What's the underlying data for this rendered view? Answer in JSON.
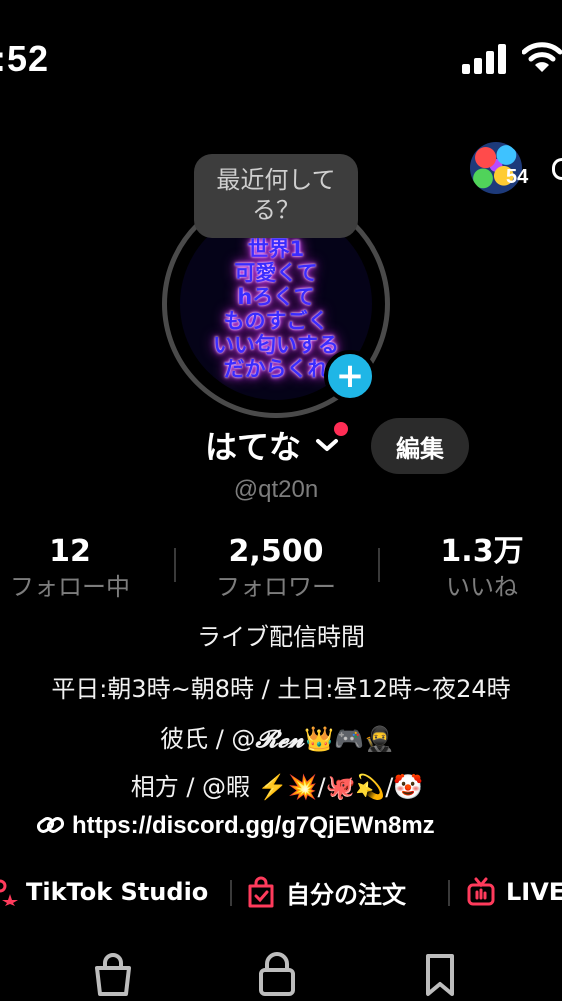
{
  "status_bar": {
    "time": ":52"
  },
  "top_right": {
    "badge_count": "54"
  },
  "profile": {
    "avatar_text": [
      "世界1",
      "可愛くて",
      "hろくて",
      "ものすごく",
      "いい匂いする",
      "だからくれ"
    ],
    "bubble_text": [
      "最近何して",
      "る？"
    ],
    "add_label": "+",
    "name": "はてな",
    "edit_label": "編集",
    "handle": "@qt20n"
  },
  "stats": [
    {
      "value": "12",
      "label": "フォロー中"
    },
    {
      "value": "2,500",
      "label": "フォロワー"
    },
    {
      "value": "1.3万",
      "label": "いいね"
    }
  ],
  "bio": {
    "line1": "ライブ配信時間",
    "line2": "平日:朝3時~朝8時 / 土日:昼12時~夜24時",
    "line3_prefix": "彼氏 / @",
    "line3_name": "𝓡𝓮𝓷",
    "line3_emoji": "👑🎮🥷",
    "line4": "相方 / @暇 ⚡️💥/🐙💫/🤡",
    "link": "https://discord.gg/g7QjEWn8mz"
  },
  "tools": [
    {
      "label": "TikTok Studio"
    },
    {
      "label": "自分の注文"
    },
    {
      "label": "LIVE"
    }
  ],
  "colors": {
    "accent_pink": "#ff3b5c",
    "accent_cyan": "#1fb6e6",
    "background": "#000000"
  }
}
